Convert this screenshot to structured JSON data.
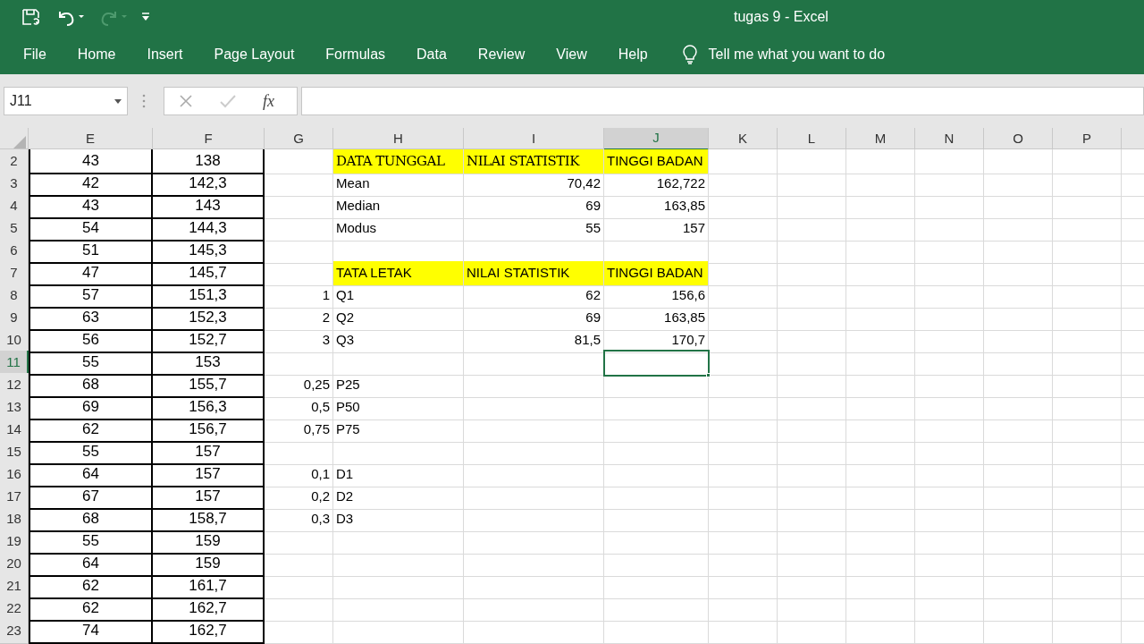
{
  "window": {
    "title": "tugas 9  -  Excel"
  },
  "quick_access": [
    {
      "kind": "save",
      "disabled": false
    },
    {
      "kind": "undo",
      "disabled": false
    },
    {
      "kind": "redo",
      "disabled": true
    },
    {
      "kind": "customize",
      "disabled": false
    }
  ],
  "ribbon_tabs": [
    "File",
    "Home",
    "Insert",
    "Page Layout",
    "Formulas",
    "Data",
    "Review",
    "View",
    "Help"
  ],
  "tell_me": {
    "placeholder": "Tell me what you want to do"
  },
  "formula_bar": {
    "name_box": "J11",
    "fx": "fx"
  },
  "columns": [
    {
      "label": "E",
      "selected": false
    },
    {
      "label": "F",
      "selected": false
    },
    {
      "label": "G",
      "selected": false
    },
    {
      "label": "H",
      "selected": false
    },
    {
      "label": "I",
      "selected": false
    },
    {
      "label": "J",
      "selected": true
    },
    {
      "label": "K",
      "selected": false
    },
    {
      "label": "L",
      "selected": false
    },
    {
      "label": "M",
      "selected": false
    },
    {
      "label": "N",
      "selected": false
    },
    {
      "label": "O",
      "selected": false
    },
    {
      "label": "P",
      "selected": false
    }
  ],
  "rows": [
    {
      "number": "2",
      "selected": false,
      "cells": {
        "E": {
          "text": "43",
          "kind": "centered"
        },
        "F": {
          "text": "138",
          "kind": "centered"
        },
        "H": {
          "text": "DATA TUNGGAL",
          "kind": "title",
          "color": "#ffff00"
        },
        "I": {
          "text": "NILAI STATISTIK",
          "kind": "title",
          "color": "#ffff00"
        },
        "J": {
          "text": "TINGGI BADAN",
          "kind": "text",
          "color": "#ffff00"
        }
      }
    },
    {
      "number": "3",
      "selected": false,
      "cells": {
        "E": {
          "text": "42",
          "kind": "centered"
        },
        "F": {
          "text": "142,3",
          "kind": "centered"
        },
        "H": {
          "text": "Mean",
          "kind": "text"
        },
        "I": {
          "text": "70,42",
          "kind": "number"
        },
        "J": {
          "text": "162,722",
          "kind": "number"
        }
      }
    },
    {
      "number": "4",
      "selected": false,
      "cells": {
        "E": {
          "text": "43",
          "kind": "centered"
        },
        "F": {
          "text": "143",
          "kind": "centered"
        },
        "H": {
          "text": "Median",
          "kind": "text"
        },
        "I": {
          "text": "69",
          "kind": "number"
        },
        "J": {
          "text": "163,85",
          "kind": "number"
        }
      }
    },
    {
      "number": "5",
      "selected": false,
      "cells": {
        "E": {
          "text": "54",
          "kind": "centered"
        },
        "F": {
          "text": "144,3",
          "kind": "centered"
        },
        "H": {
          "text": "Modus",
          "kind": "text"
        },
        "I": {
          "text": "55",
          "kind": "number"
        },
        "J": {
          "text": "157",
          "kind": "number"
        }
      }
    },
    {
      "number": "6",
      "selected": false,
      "cells": {
        "E": {
          "text": "51",
          "kind": "centered"
        },
        "F": {
          "text": "145,3",
          "kind": "centered"
        }
      }
    },
    {
      "number": "7",
      "selected": false,
      "cells": {
        "E": {
          "text": "47",
          "kind": "centered"
        },
        "F": {
          "text": "145,7",
          "kind": "centered"
        },
        "H": {
          "text": "TATA LETAK",
          "kind": "text",
          "color": "#ffff00"
        },
        "I": {
          "text": "NILAI STATISTIK",
          "kind": "text",
          "color": "#ffff00"
        },
        "J": {
          "text": "TINGGI BADAN",
          "kind": "text",
          "color": "#ffff00"
        }
      }
    },
    {
      "number": "8",
      "selected": false,
      "cells": {
        "E": {
          "text": "57",
          "kind": "centered"
        },
        "F": {
          "text": "151,3",
          "kind": "centered"
        },
        "G": {
          "text": "1",
          "kind": "number"
        },
        "H": {
          "text": "Q1",
          "kind": "text"
        },
        "I": {
          "text": "62",
          "kind": "number"
        },
        "J": {
          "text": "156,6",
          "kind": "number"
        }
      }
    },
    {
      "number": "9",
      "selected": false,
      "cells": {
        "E": {
          "text": "63",
          "kind": "centered"
        },
        "F": {
          "text": "152,3",
          "kind": "centered"
        },
        "G": {
          "text": "2",
          "kind": "number"
        },
        "H": {
          "text": "Q2",
          "kind": "text"
        },
        "I": {
          "text": "69",
          "kind": "number"
        },
        "J": {
          "text": "163,85",
          "kind": "number"
        }
      }
    },
    {
      "number": "10",
      "selected": false,
      "cells": {
        "E": {
          "text": "56",
          "kind": "centered"
        },
        "F": {
          "text": "152,7",
          "kind": "centered"
        },
        "G": {
          "text": "3",
          "kind": "number"
        },
        "H": {
          "text": "Q3",
          "kind": "text"
        },
        "I": {
          "text": "81,5",
          "kind": "number"
        },
        "J": {
          "text": "170,7",
          "kind": "number"
        }
      }
    },
    {
      "number": "11",
      "selected": true,
      "cells": {
        "E": {
          "text": "55",
          "kind": "centered"
        },
        "F": {
          "text": "153",
          "kind": "centered"
        }
      }
    },
    {
      "number": "12",
      "selected": false,
      "cells": {
        "E": {
          "text": "68",
          "kind": "centered"
        },
        "F": {
          "text": "155,7",
          "kind": "centered"
        },
        "G": {
          "text": "0,25",
          "kind": "number"
        },
        "H": {
          "text": "P25",
          "kind": "text"
        }
      }
    },
    {
      "number": "13",
      "selected": false,
      "cells": {
        "E": {
          "text": "69",
          "kind": "centered"
        },
        "F": {
          "text": "156,3",
          "kind": "centered"
        },
        "G": {
          "text": "0,5",
          "kind": "number"
        },
        "H": {
          "text": "P50",
          "kind": "text"
        }
      }
    },
    {
      "number": "14",
      "selected": false,
      "cells": {
        "E": {
          "text": "62",
          "kind": "centered"
        },
        "F": {
          "text": "156,7",
          "kind": "centered"
        },
        "G": {
          "text": "0,75",
          "kind": "number"
        },
        "H": {
          "text": "P75",
          "kind": "text"
        }
      }
    },
    {
      "number": "15",
      "selected": false,
      "cells": {
        "E": {
          "text": "55",
          "kind": "centered"
        },
        "F": {
          "text": "157",
          "kind": "centered"
        }
      }
    },
    {
      "number": "16",
      "selected": false,
      "cells": {
        "E": {
          "text": "64",
          "kind": "centered"
        },
        "F": {
          "text": "157",
          "kind": "centered"
        },
        "G": {
          "text": "0,1",
          "kind": "number"
        },
        "H": {
          "text": "D1",
          "kind": "text"
        }
      }
    },
    {
      "number": "17",
      "selected": false,
      "cells": {
        "E": {
          "text": "67",
          "kind": "centered"
        },
        "F": {
          "text": "157",
          "kind": "centered"
        },
        "G": {
          "text": "0,2",
          "kind": "number"
        },
        "H": {
          "text": "D2",
          "kind": "text"
        }
      }
    },
    {
      "number": "18",
      "selected": false,
      "cells": {
        "E": {
          "text": "68",
          "kind": "centered"
        },
        "F": {
          "text": "158,7",
          "kind": "centered"
        },
        "G": {
          "text": "0,3",
          "kind": "number"
        },
        "H": {
          "text": "D3",
          "kind": "text"
        }
      }
    },
    {
      "number": "19",
      "selected": false,
      "cells": {
        "E": {
          "text": "55",
          "kind": "centered"
        },
        "F": {
          "text": "159",
          "kind": "centered"
        }
      }
    },
    {
      "number": "20",
      "selected": false,
      "cells": {
        "E": {
          "text": "64",
          "kind": "centered"
        },
        "F": {
          "text": "159",
          "kind": "centered"
        }
      }
    },
    {
      "number": "21",
      "selected": false,
      "cells": {
        "E": {
          "text": "62",
          "kind": "centered"
        },
        "F": {
          "text": "161,7",
          "kind": "centered"
        }
      }
    },
    {
      "number": "22",
      "selected": false,
      "cells": {
        "E": {
          "text": "62",
          "kind": "centered"
        },
        "F": {
          "text": "162,7",
          "kind": "centered"
        }
      }
    },
    {
      "number": "23",
      "selected": false,
      "cells": {
        "E": {
          "text": "74",
          "kind": "centered"
        },
        "F": {
          "text": "162,7",
          "kind": "centered"
        }
      }
    }
  ]
}
